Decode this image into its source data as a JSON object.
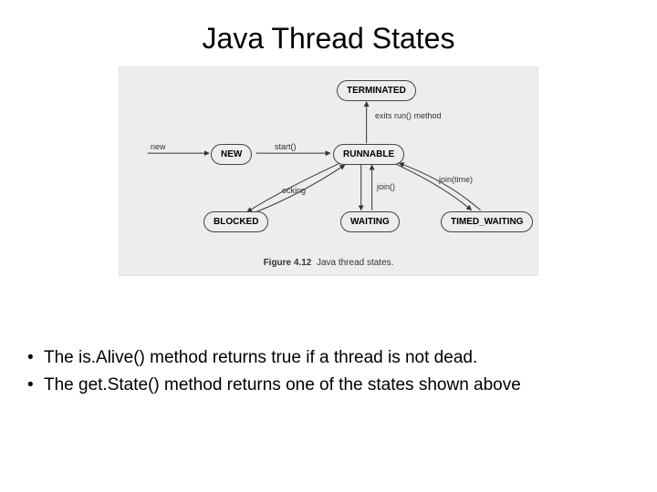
{
  "title": "Java Thread States",
  "states": {
    "terminated": "TERMINATED",
    "new": "NEW",
    "runnable": "RUNNABLE",
    "blocked": "BLOCKED",
    "waiting": "WAITING",
    "timed_waiting": "TIMED_WAITING"
  },
  "edges": {
    "new_label": "new",
    "start": "start()",
    "exits_run": "exits run() method",
    "locking": "ocking",
    "join": "join()",
    "join_time": "join(time)"
  },
  "caption_prefix": "Figure 4.12",
  "caption_text": "Java thread states.",
  "bullets": [
    "The is.Alive() method returns true if a thread is not dead.",
    "The get.State() method returns one of the states shown above"
  ]
}
